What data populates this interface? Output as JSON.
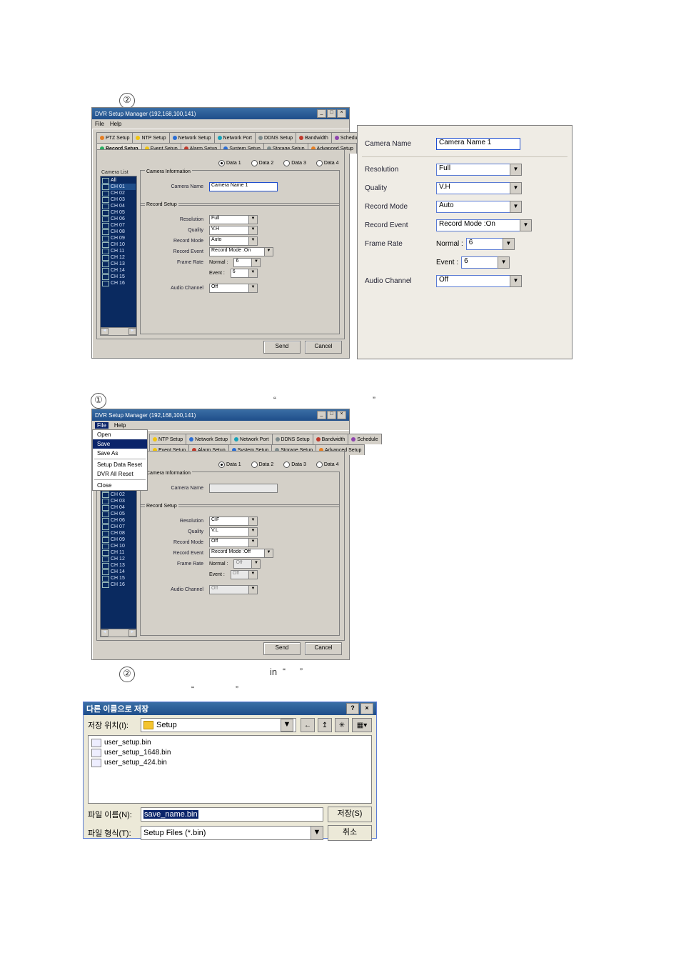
{
  "marker": {
    "num2_top": "②",
    "num1_mid": "①",
    "num2_bot": "②"
  },
  "text": {
    "quote_open": "“",
    "quote_close": "”",
    "quote_open2": "“",
    "quote_close2": "”",
    "in_word": "in",
    "quote_open3": "“",
    "quote_close3": "”"
  },
  "dvr": {
    "title": "DVR Setup Manager (192,168,100,141)",
    "menu": {
      "file": "File",
      "help": "Help"
    },
    "file_menu": {
      "open": "Open",
      "save": "Save",
      "save_as": "Save As",
      "setup_data_reset": "Setup Data Reset",
      "dvr_all_reset": "DVR All Reset",
      "close": "Close"
    },
    "tabs_row1": {
      "ptz": "PTZ Setup",
      "ntp": "NTP Setup",
      "network": "Network Setup",
      "port": "Network Port",
      "ddns": "DDNS Setup",
      "bandwidth": "Bandwidth",
      "schedule": "Schedule"
    },
    "tabs_row2": {
      "record": "Record Setup",
      "event": "Event Setup",
      "alarm": "Alarm Setup",
      "system": "System Setup",
      "storage": "Storage Setup",
      "advanced": "Advanced Setup"
    },
    "data": {
      "d1": "Data 1",
      "d2": "Data 2",
      "d3": "Data 3",
      "d4": "Data 4"
    },
    "cam_list_label": "Camera List",
    "cam_list": {
      "all": "All",
      "c1": "CH 01",
      "c2": "CH 02",
      "c3": "CH 03",
      "c4": "CH 04",
      "c5": "CH 05",
      "c6": "CH 06",
      "c7": "CH 07",
      "c8": "CH 08",
      "c9": "CH 09",
      "c10": "CH 10",
      "c11": "CH 11",
      "c12": "CH 12",
      "c13": "CH 13",
      "c14": "CH 14",
      "c15": "CH 15",
      "c16": "CH 16"
    },
    "scroll_left": "◄",
    "scroll_right": "►",
    "caminfo_title": "Camera Information",
    "recsetup_title": "Record Setup",
    "labels": {
      "camera_name": "Camera Name",
      "resolution": "Resolution",
      "quality": "Quality",
      "record_mode": "Record Mode",
      "record_event": "Record Event",
      "frame_rate": "Frame Rate",
      "normal": "Normal : ",
      "event": "Event : ",
      "audio_channel": "Audio Channel"
    },
    "values1": {
      "camera_name": "Camera Name 1",
      "resolution": "Full",
      "quality": "V.H",
      "record_mode": "Auto",
      "record_event": "Record Mode :On",
      "frame_normal": "6",
      "frame_event": "6",
      "audio": "Off",
      "dd": "▼"
    },
    "values2": {
      "camera_name": "",
      "resolution": "CIF",
      "quality": "V.L",
      "record_mode": "Off",
      "record_event": "Record Mode :Off",
      "frame_normal": "Off",
      "frame_event": "Off",
      "audio": "Off",
      "dd": "▼"
    },
    "buttons": {
      "send": "Send",
      "cancel": "Cancel"
    }
  },
  "detail": {
    "camera_name_lab": "Camera Name",
    "camera_name_val": "Camera Name 1",
    "resolution_lab": "Resolution",
    "resolution_val": "Full",
    "quality_lab": "Quality",
    "quality_val": "V.H",
    "record_mode_lab": "Record Mode",
    "record_mode_val": "Auto",
    "record_event_lab": "Record Event",
    "record_event_val": "Record Mode :On",
    "frame_rate_lab": "Frame Rate",
    "normal_lab": "Normal : ",
    "normal_val": "6",
    "event_lab": "Event : ",
    "event_val": "6",
    "audio_lab": "Audio Channel",
    "audio_val": "Off",
    "dd": "▼"
  },
  "saveas": {
    "title": "다른 이름으로 저장",
    "help": "?",
    "close": "×",
    "loc_label": "저장 위치(I):",
    "loc_value": "Setup",
    "dd": "▼",
    "tool_back": "←",
    "tool_up": "↥",
    "tool_new": "✳",
    "tool_view": "▦",
    "tool_view_dd": "▾",
    "files": {
      "f1": "user_setup.bin",
      "f2": "user_setup_1648.bin",
      "f3": "user_setup_424.bin"
    },
    "fname_label": "파일 이름(N):",
    "fname_value": "save_name.bin",
    "ftype_label": "파일 형식(T):",
    "ftype_value": "Setup Files (*.bin)",
    "save_btn": "저장(S)",
    "cancel_btn": "취소"
  }
}
